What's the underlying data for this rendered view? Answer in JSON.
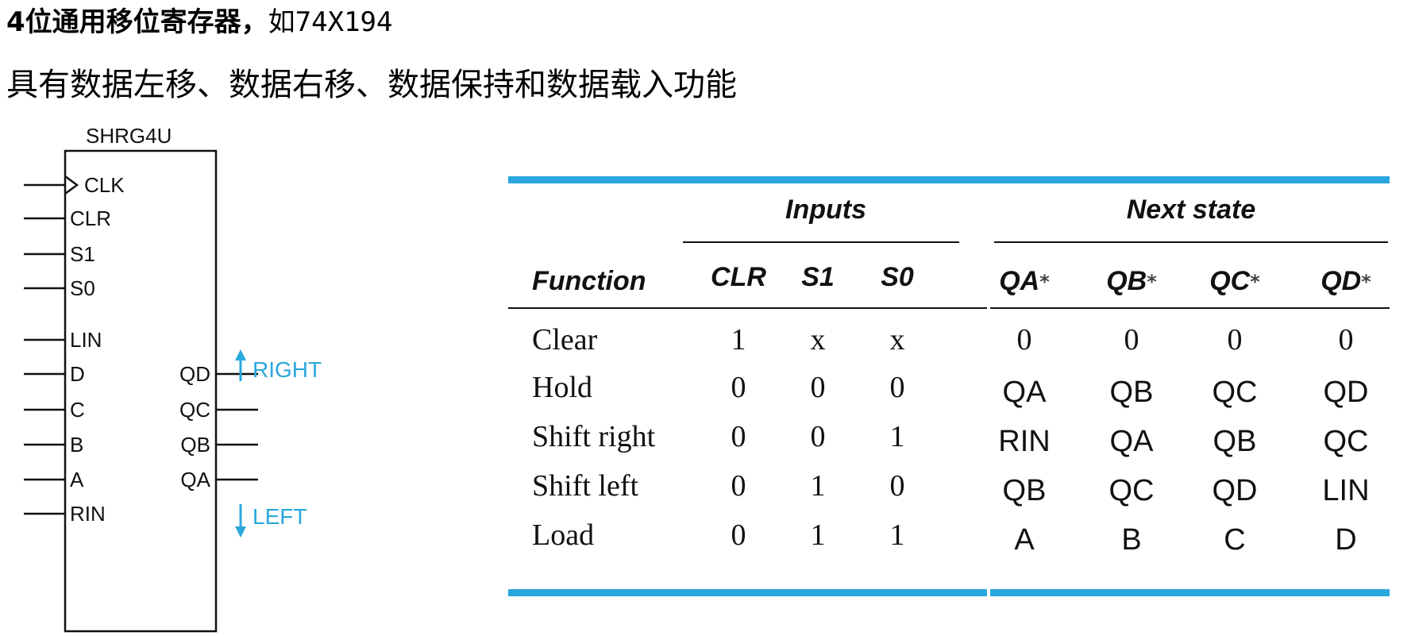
{
  "header": {
    "title_bold": "4位通用移位寄存器，",
    "title_rest": "如74X194",
    "subtitle": "具有数据左移、数据右移、数据保持和数据载入功能"
  },
  "chip": {
    "name": "SHRG4U",
    "left_pins": [
      "CLK",
      "CLR",
      "S1",
      "S0",
      "LIN",
      "D",
      "C",
      "B",
      "A",
      "RIN"
    ],
    "right_pins": [
      "QD",
      "QC",
      "QB",
      "QA"
    ],
    "right_label": "RIGHT",
    "left_label": "LEFT",
    "accent_color": "#2aa7dc"
  },
  "table": {
    "group_inputs": "Inputs",
    "group_next_state": "Next state",
    "function_header": "Function",
    "input_headers": [
      "CLR",
      "S1",
      "S0"
    ],
    "state_headers": [
      "QA",
      "QB",
      "QC",
      "QD"
    ],
    "star": "*",
    "rows": [
      {
        "function": "Clear",
        "inputs": [
          "1",
          "x",
          "x"
        ],
        "next": [
          "0",
          "0",
          "0",
          "0"
        ]
      },
      {
        "function": "Hold",
        "inputs": [
          "0",
          "0",
          "0"
        ],
        "next": [
          "QA",
          "QB",
          "QC",
          "QD"
        ]
      },
      {
        "function": "Shift right",
        "inputs": [
          "0",
          "0",
          "1"
        ],
        "next": [
          "RIN",
          "QA",
          "QB",
          "QC"
        ]
      },
      {
        "function": "Shift left",
        "inputs": [
          "0",
          "1",
          "0"
        ],
        "next": [
          "QB",
          "QC",
          "QD",
          "LIN"
        ]
      },
      {
        "function": "Load",
        "inputs": [
          "0",
          "1",
          "1"
        ],
        "next": [
          "A",
          "B",
          "C",
          "D"
        ]
      }
    ],
    "rule_color": "#2aa7dc"
  }
}
